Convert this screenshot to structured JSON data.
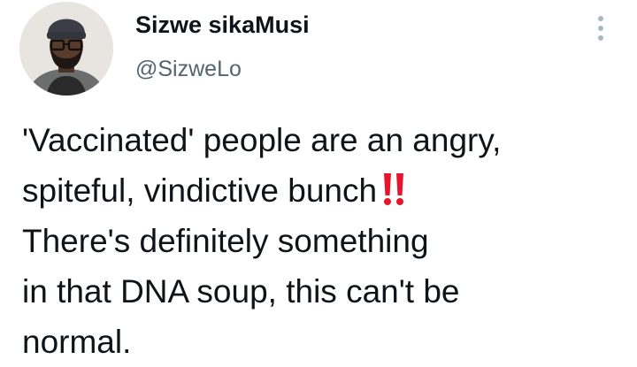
{
  "author": {
    "display_name": "Sizwe sikaMusi",
    "handle": "@SizweLo",
    "avatar_icon": "profile-photo"
  },
  "menu": {
    "icon": "more-options-vertical-icon"
  },
  "tweet": {
    "lines": [
      "'Vaccinated' people are an angry,",
      "spiteful, vindictive bunch",
      "There's definitely something",
      "in that DNA soup, this can't be",
      "normal."
    ],
    "inline_emoji": "double-exclamation-mark-icon"
  },
  "colors": {
    "text": "#0f1419",
    "secondary_text": "#536471",
    "emoji_red": "#e8132c",
    "menu_dots": "#aab8c2"
  }
}
